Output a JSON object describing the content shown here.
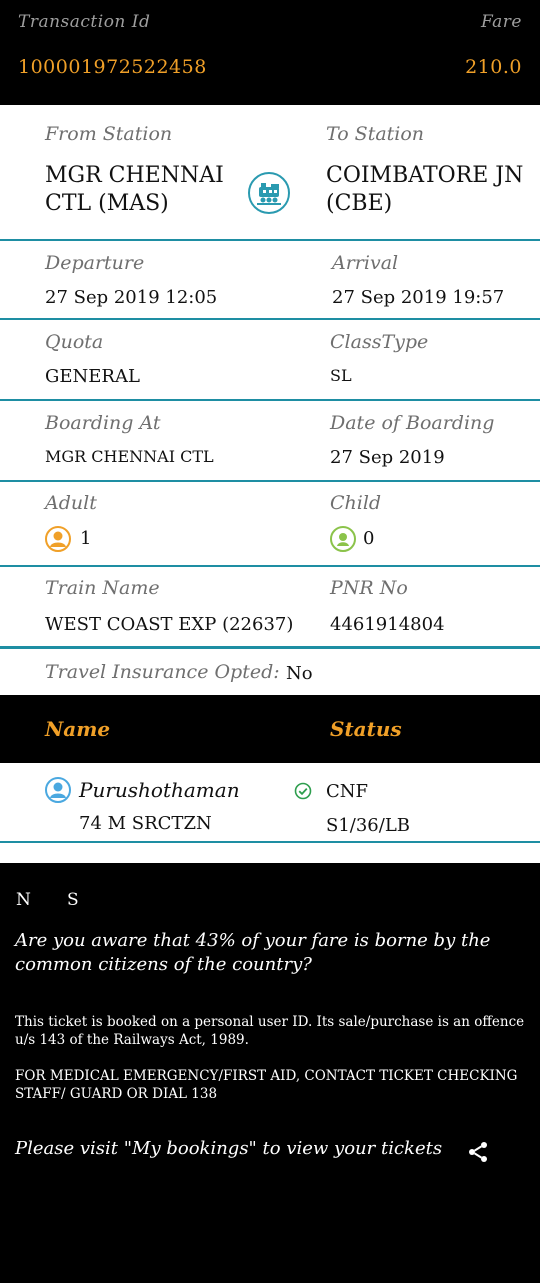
{
  "header": {
    "transaction_label": "Transaction Id",
    "fare_label": "Fare",
    "transaction_id": "100001972522458",
    "fare": "210.0"
  },
  "journey": {
    "from_label": "From Station",
    "from_value": [
      "MGR CHENNAI",
      "CTL (MAS)"
    ],
    "to_label": "To Station",
    "to_value": [
      "COIMBATORE JN",
      "(CBE)"
    ],
    "departure_label": "Departure",
    "departure_value": "27 Sep 2019 12:05",
    "arrival_label": "Arrival",
    "arrival_value": "27 Sep 2019 19:57",
    "quota_label": "Quota",
    "quota_value": "GENERAL",
    "class_label": "ClassType",
    "class_value": "SL",
    "boarding_label": "Boarding At",
    "boarding_value": "MGR CHENNAI CTL",
    "date_boarding_label": "Date of Boarding",
    "date_boarding_value": "27 Sep 2019",
    "adult_label": "Adult",
    "adult_value": "1",
    "child_label": "Child",
    "child_value": "0",
    "train_label": "Train Name",
    "train_value": "WEST COAST EXP (22637)",
    "pnr_label": "PNR No",
    "pnr_value": "4461914804",
    "insurance_label": "Travel Insurance Opted:",
    "insurance_value": "No"
  },
  "passengers": {
    "name_header": "Name",
    "status_header": "Status",
    "rows": [
      {
        "name": "Purushothaman",
        "details": "74 M SRCTZN",
        "status": "CNF",
        "berth": "S1/36/LB"
      }
    ]
  },
  "notes": {
    "legend_n": "N",
    "legend_s": "S",
    "subsidy": "Are you aware that 43% of your fare is borne by the common citizens of the country?",
    "personal_id": "This ticket is booked on a personal user ID. Its sale/purchase is an offence u/s 143 of the Railways Act, 1989.",
    "medical": "FOR MEDICAL EMERGENCY/FIRST AID, CONTACT TICKET CHECKING STAFF/ GUARD OR DIAL 138",
    "bookings": "Please visit \"My bookings\" to view your tickets"
  },
  "icons": {
    "train": "train-icon",
    "adult": "adult-icon",
    "child": "child-icon",
    "passenger": "passenger-icon",
    "confirmed": "check-circle-icon",
    "share": "share-icon"
  },
  "colors": {
    "accent": "#f0a028",
    "divider": "#1e8ea3",
    "confirmed": "#2e9e4e",
    "passenger_icon": "#4aa8e0"
  }
}
